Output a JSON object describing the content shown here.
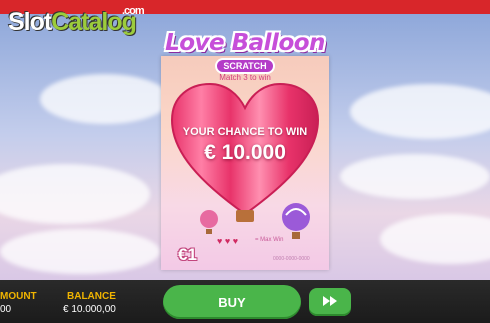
{
  "watermark": {
    "part1": "Slot",
    "part2": "Catalog",
    "suffix": ".com"
  },
  "game": {
    "title": "Love Balloon",
    "subtitle": "SCRATCH",
    "match_text": "Match 3 to win",
    "chance_text": "YOUR CHANCE TO WIN",
    "max_prize": "€ 10.000",
    "price": "€1",
    "hearts": "♥ ♥ ♥",
    "max_win_label": "= Max Win",
    "ticket_number": "0000-0000-0000"
  },
  "bottom": {
    "amount_label": "MOUNT",
    "amount_value": "00",
    "balance_label": "BALANCE",
    "balance_value": "€ 10.000,00",
    "buy_label": "BUY",
    "fast_icon": "fast-forward-icon"
  },
  "colors": {
    "top_bar": "#d8262a",
    "bottom_bar": "#1b1b1b",
    "accent_green": "#4ab54a",
    "label_gold": "#f0b400",
    "heart_pink": "#e8336a"
  }
}
